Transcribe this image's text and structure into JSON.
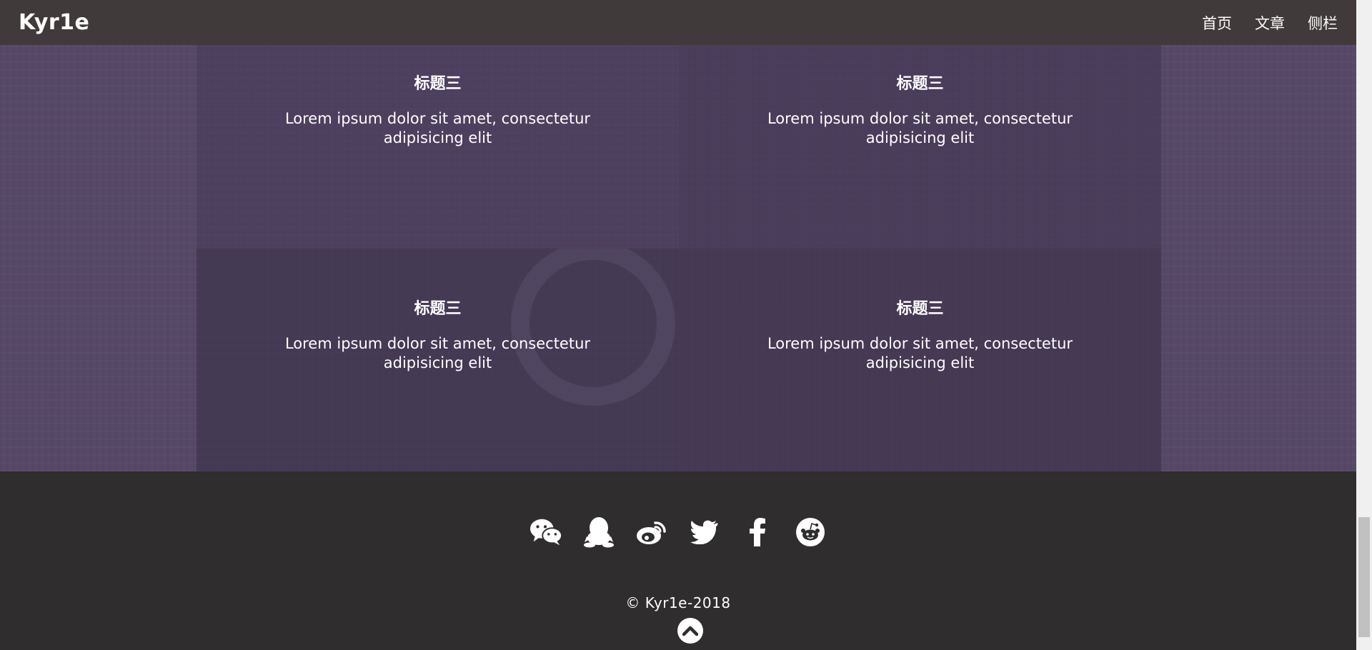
{
  "navbar": {
    "brand": "Kyr1e",
    "links": [
      "首页",
      "文章",
      "侧栏"
    ]
  },
  "cards": [
    {
      "title": "标题三",
      "text": "Lorem ipsum dolor sit amet, consectetur adipisicing elit"
    },
    {
      "title": "标题三",
      "text": "Lorem ipsum dolor sit amet, consectetur adipisicing elit"
    },
    {
      "title": "标题三",
      "text": "Lorem ipsum dolor sit amet, consectetur adipisicing elit"
    },
    {
      "title": "标题三",
      "text": "Lorem ipsum dolor sit amet, consectetur adipisicing elit"
    }
  ],
  "footer": {
    "socials": [
      "wechat-icon",
      "qq-icon",
      "weibo-icon",
      "twitter-icon",
      "facebook-icon",
      "reddit-icon"
    ],
    "copyright": "© Kyr1e-2018"
  },
  "colors": {
    "navbar": "#413a3b",
    "hero": "#574868",
    "footer": "#2f2d2d",
    "text": "#ffffff"
  }
}
